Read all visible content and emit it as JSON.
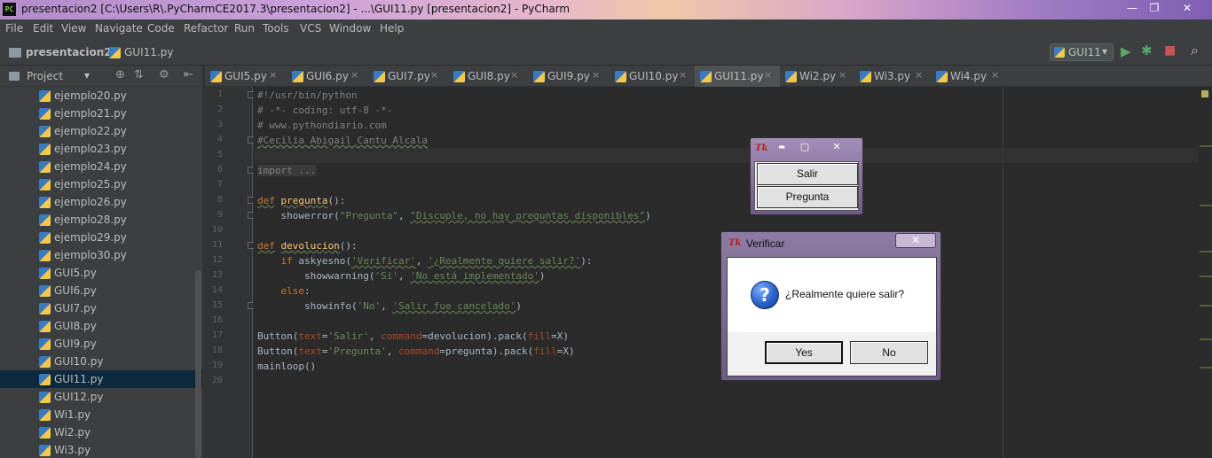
{
  "window": {
    "title": "presentacion2 [C:\\Users\\R\\.PyCharmCE2017.3\\presentacion2] - ...\\GUI11.py [presentacion2] - PyCharm",
    "logo_text": "PC",
    "minimize": "—",
    "maximize": "❐",
    "close": "✕"
  },
  "menubar": {
    "items": [
      "File",
      "Edit",
      "View",
      "Navigate",
      "Code",
      "Refactor",
      "Run",
      "Tools",
      "VCS",
      "Window",
      "Help"
    ]
  },
  "navbar": {
    "project": "presentacion2",
    "file": "GUI11.py",
    "run_config": "GUI11",
    "dropdown_icon": "▾",
    "run_icon": "▶",
    "debug_icon": "✱",
    "stop_icon": "■",
    "search_icon": "⌕"
  },
  "project_panel": {
    "title": "Project",
    "dropdown_icon": "▾",
    "tool_icons": [
      "⊕",
      "⇅",
      "⚙",
      "⇤"
    ],
    "files": [
      "ejemplo20.py",
      "ejemplo21.py",
      "ejemplo22.py",
      "ejemplo23.py",
      "ejemplo24.py",
      "ejemplo25.py",
      "ejemplo26.py",
      "ejemplo28.py",
      "ejemplo29.py",
      "ejemplo30.py",
      "GUI5.py",
      "GUI6.py",
      "GUI7.py",
      "GUI8.py",
      "GUI9.py",
      "GUI10.py",
      "GUI11.py",
      "GUI12.py",
      "Wi1.py",
      "Wi2.py",
      "Wi3.py"
    ],
    "selected": "GUI11.py"
  },
  "tabs": {
    "items": [
      "GUI5.py",
      "GUI6.py",
      "GUI7.py",
      "GUI8.py",
      "GUI9.py",
      "GUI10.py",
      "GUI11.py",
      "Wi2.py",
      "Wi3.py",
      "Wi4.py"
    ],
    "active": "GUI11.py",
    "close_glyph": "×"
  },
  "editor": {
    "line_numbers": [
      "1",
      "2",
      "3",
      "4",
      "5",
      "6",
      "7",
      "8",
      "9",
      "10",
      "11",
      "12",
      "13",
      "14",
      "15",
      "16",
      "17",
      "18",
      "19",
      "20"
    ],
    "code": {
      "l1": "#!/usr/bin/python",
      "l2": "# -*- coding: utf-8 -*-",
      "l3": "# www.pythondiario.com",
      "l4": "#Cecilia Abigail Cantu Alcala",
      "l6": "import ...",
      "l9_kw": "def",
      "l9_fn": "pregunta",
      "l9_rest": "():",
      "l10_a": "    showerror(",
      "l10_s1": "\"Pregunta\"",
      "l10_b": ", ",
      "l10_s2": "\"Discuple, no hay preguntas disponibles\"",
      "l10_c": ")",
      "l12_kw": "def",
      "l12_fn": "devolucion",
      "l12_rest": "():",
      "l13_a": "    ",
      "l13_kw": "if",
      "l13_b": " askyesno(",
      "l13_s1": "'Verificar'",
      "l13_c": ", ",
      "l13_s2": "'¿Realmente quiere salir?'",
      "l13_d": "):",
      "l14_a": "        showwarning(",
      "l14_s1": "'Si'",
      "l14_b": ", ",
      "l14_s2": "'No está implementado'",
      "l14_c": ")",
      "l15_a": "    ",
      "l15_kw": "else",
      "l15_b": ":",
      "l16_a": "        showinfo(",
      "l16_s1": "'No'",
      "l16_b": ", ",
      "l16_s2": "'Salir fue cancelado'",
      "l16_c": ")",
      "l18_a": "Button(",
      "l18_p1": "text",
      "l18_b": "=",
      "l18_s1": "'Salir'",
      "l18_c": ", ",
      "l18_p2": "command",
      "l18_d": "=devolucion).pack(",
      "l18_p3": "fill",
      "l18_e": "=X)",
      "l19_a": "Button(",
      "l19_p1": "text",
      "l19_b": "=",
      "l19_s1": "'Pregunta'",
      "l19_c": ", ",
      "l19_p2": "command",
      "l19_d": "=pregunta).pack(",
      "l19_p3": "fill",
      "l19_e": "=X)",
      "l20": "mainloop()"
    }
  },
  "tk_root": {
    "icon": "Tk",
    "minimize": "▬",
    "maximize": "▢",
    "close": "✕",
    "buttons": [
      "Salir",
      "Pregunta"
    ]
  },
  "dialog": {
    "icon": "Tk",
    "title": "Verificar",
    "close": "✕",
    "question_icon": "?",
    "message": "¿Realmente quiere salir?",
    "yes": "Yes",
    "no": "No"
  },
  "colors": {
    "editor_bg": "#2b2b2b",
    "keyword": "#cc7832",
    "string": "#6a8759",
    "function": "#ffc66d",
    "comment": "#808080",
    "selection": "#0d293e"
  }
}
